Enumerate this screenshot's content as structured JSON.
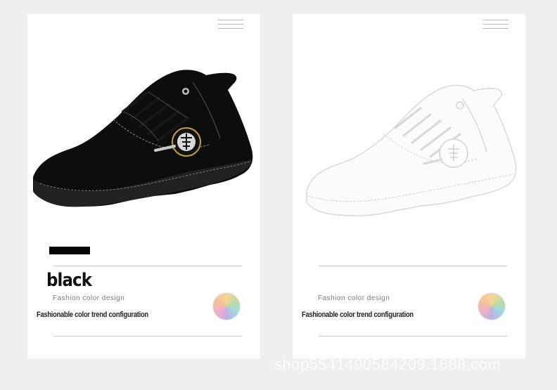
{
  "cards": [
    {
      "color_name": "black",
      "fashion_label": "Fashion color design",
      "tagline": "Fashionable color trend configuration",
      "swatch_color": "#050505"
    },
    {
      "color_name": "",
      "fashion_label": "Fashion color design",
      "tagline": "Fashionable color trend configuration",
      "swatch_color": ""
    }
  ],
  "icons": {
    "menu": "hamburger-menu-icon",
    "color_wheel": "color-wheel-icon"
  },
  "watermark": "shop5541490584209.1688.com",
  "colors": {
    "background": "#efefef",
    "card": "#ffffff",
    "black_shoe": "#0b0b0b",
    "outline_shoe": "#d8d8d8"
  }
}
